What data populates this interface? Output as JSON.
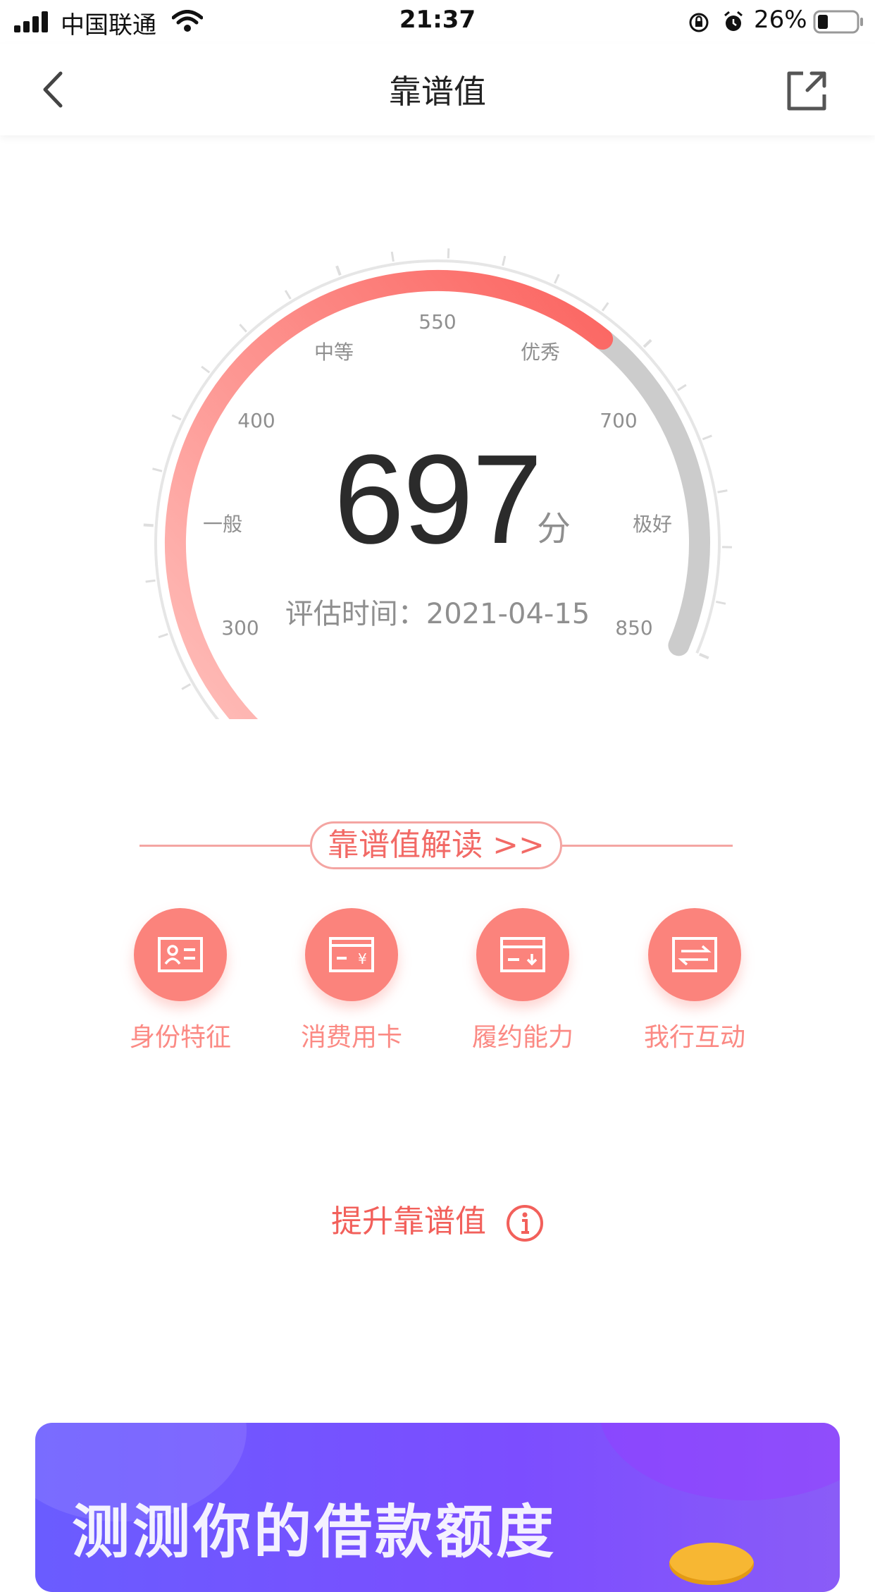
{
  "status_bar": {
    "carrier": "中国联通",
    "time": "21:37",
    "battery": "26%"
  },
  "nav": {
    "title": "靠谱值"
  },
  "gauge": {
    "score": "697",
    "unit": "分",
    "eval_date": "评估时间：2021-04-15",
    "min": 300,
    "max": 850,
    "value": 697,
    "ticks": [
      "300",
      "400",
      "550",
      "700",
      "850"
    ],
    "ratings": [
      "一般",
      "中等",
      "优秀",
      "极好"
    ],
    "colors": {
      "arc_start": "#ffc4c0",
      "arc_end": "#fb6460",
      "arc_rest": "#cccccc",
      "outer_ring": "#e6e6e6"
    }
  },
  "interpretation": {
    "button_label": "靠谱值解读 >>",
    "categories": [
      {
        "label": "身份特征",
        "icon": "id-card-icon"
      },
      {
        "label": "消费用卡",
        "icon": "bank-card-yuan-icon"
      },
      {
        "label": "履约能力",
        "icon": "card-download-icon"
      },
      {
        "label": "我行互动",
        "icon": "transfer-icon"
      }
    ]
  },
  "boost": {
    "label": "提升靠谱值",
    "icon": "info-icon"
  },
  "banner": {
    "title": "测测你的借款额度"
  }
}
